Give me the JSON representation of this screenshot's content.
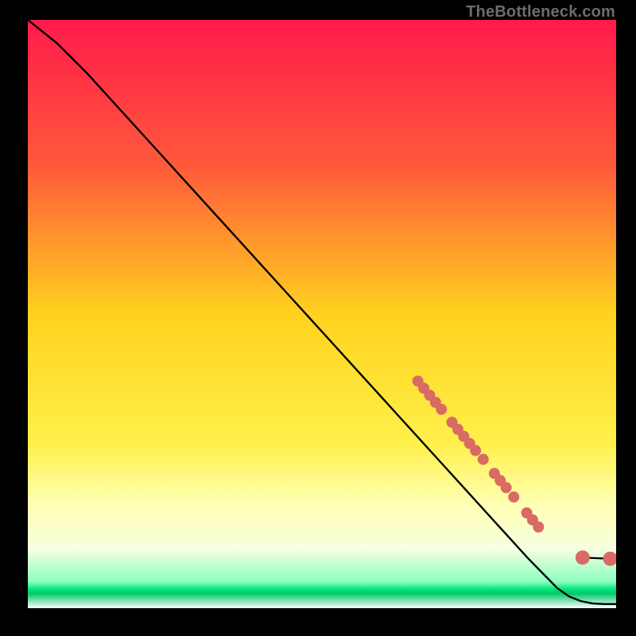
{
  "attribution": "TheBottleneck.com",
  "chart_data": {
    "type": "line",
    "title": "",
    "xlabel": "",
    "ylabel": "",
    "xlim": [
      0,
      100
    ],
    "ylim": [
      0,
      100
    ],
    "grid": false,
    "legend": false,
    "gradient_stops": [
      {
        "pos": 0.0,
        "color": "#ff1a4b"
      },
      {
        "pos": 0.25,
        "color": "#ff5a3a"
      },
      {
        "pos": 0.5,
        "color": "#ffd21e"
      },
      {
        "pos": 0.72,
        "color": "#fff04a"
      },
      {
        "pos": 0.82,
        "color": "#ffffb0"
      },
      {
        "pos": 0.9,
        "color": "#f6ffe0"
      },
      {
        "pos": 0.955,
        "color": "#8affc0"
      },
      {
        "pos": 0.968,
        "color": "#00e57a"
      },
      {
        "pos": 0.975,
        "color": "#00c86a"
      },
      {
        "pos": 1.0,
        "color": "#ffffff"
      }
    ],
    "series": [
      {
        "name": "curve",
        "stroke": "#000000",
        "x": [
          0,
          5,
          10,
          15,
          20,
          25,
          30,
          35,
          40,
          45,
          50,
          55,
          60,
          65,
          70,
          75,
          80,
          85,
          90,
          92,
          94,
          96,
          98,
          100
        ],
        "y": [
          100,
          96,
          91,
          85.5,
          80,
          74.5,
          69,
          63.5,
          58,
          52.5,
          47,
          41.5,
          36,
          30.5,
          25,
          19.5,
          14,
          8.5,
          3.4,
          2.0,
          1.2,
          0.8,
          0.7,
          0.7
        ]
      }
    ],
    "markers": {
      "color": "#d96a64",
      "radius_small": 6,
      "radius_large": 9,
      "points": [
        {
          "x": 66.3,
          "y": 38.6,
          "r": 7
        },
        {
          "x": 67.3,
          "y": 37.4,
          "r": 7
        },
        {
          "x": 68.3,
          "y": 36.2,
          "r": 7
        },
        {
          "x": 69.3,
          "y": 35.0,
          "r": 7
        },
        {
          "x": 70.3,
          "y": 33.8,
          "r": 7
        },
        {
          "x": 72.1,
          "y": 31.6,
          "r": 7
        },
        {
          "x": 73.1,
          "y": 30.4,
          "r": 7
        },
        {
          "x": 74.1,
          "y": 29.2,
          "r": 7
        },
        {
          "x": 75.1,
          "y": 28.0,
          "r": 7
        },
        {
          "x": 76.1,
          "y": 26.8,
          "r": 7
        },
        {
          "x": 77.4,
          "y": 25.3,
          "r": 7
        },
        {
          "x": 79.3,
          "y": 22.9,
          "r": 7
        },
        {
          "x": 80.3,
          "y": 21.7,
          "r": 7
        },
        {
          "x": 81.3,
          "y": 20.5,
          "r": 7
        },
        {
          "x": 82.6,
          "y": 18.9,
          "r": 7
        },
        {
          "x": 84.8,
          "y": 16.2,
          "r": 7
        },
        {
          "x": 85.8,
          "y": 15.0,
          "r": 7
        },
        {
          "x": 86.8,
          "y": 13.8,
          "r": 7
        },
        {
          "x": 94.3,
          "y": 8.6,
          "r": 9
        },
        {
          "x": 99.0,
          "y": 8.4,
          "r": 9
        }
      ]
    }
  }
}
